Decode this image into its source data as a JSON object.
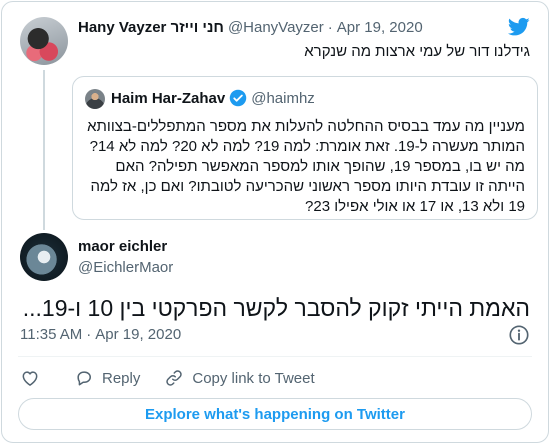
{
  "parent_tweet": {
    "display_name": "Hany Vayzer חני וייזר",
    "handle": "@HanyVayzer",
    "separator": "·",
    "date": "Apr 19, 2020",
    "text": "גידלנו דור של עמי ארצות מה שנקרא"
  },
  "quoted_tweet": {
    "display_name": "Haim Har-Zahav",
    "handle": "@haimhz",
    "verified": true,
    "text": "מעניין מה עמד בבסיס ההחלטה להעלות את מספר המתפללים-בצוותא המותר מעשרה ל-19. זאת אומרת: למה 19? למה לא 20? למה לא 14? מה יש בו, במספר 19, שהופך אותו למספר המאפשר תפילה? האם הייתה זו עובדת היותו מספר ראשוני שהכריעה לטובתו? ואם כן, אז למה 19 ולא 13, או 17 או אולי אפילו 23?"
  },
  "main_tweet": {
    "display_name": "maor eichler",
    "handle": "@EichlerMaor",
    "text": "האמת הייתי זקוק להסבר לקשר הפרקטי בין 10 ו-19...",
    "time": "11:35 AM",
    "separator": "·",
    "date": "Apr 19, 2020"
  },
  "actions": {
    "reply_label": "Reply",
    "copy_link_label": "Copy link to Tweet"
  },
  "explore_label": "Explore what's happening on Twitter",
  "colors": {
    "accent": "#1d9bf0",
    "text": "#0f1419",
    "muted": "#536471",
    "border": "#cfd9de"
  },
  "icons": [
    "twitter-bird-icon",
    "verified-badge-icon",
    "info-icon",
    "heart-icon",
    "reply-icon",
    "link-icon"
  ]
}
